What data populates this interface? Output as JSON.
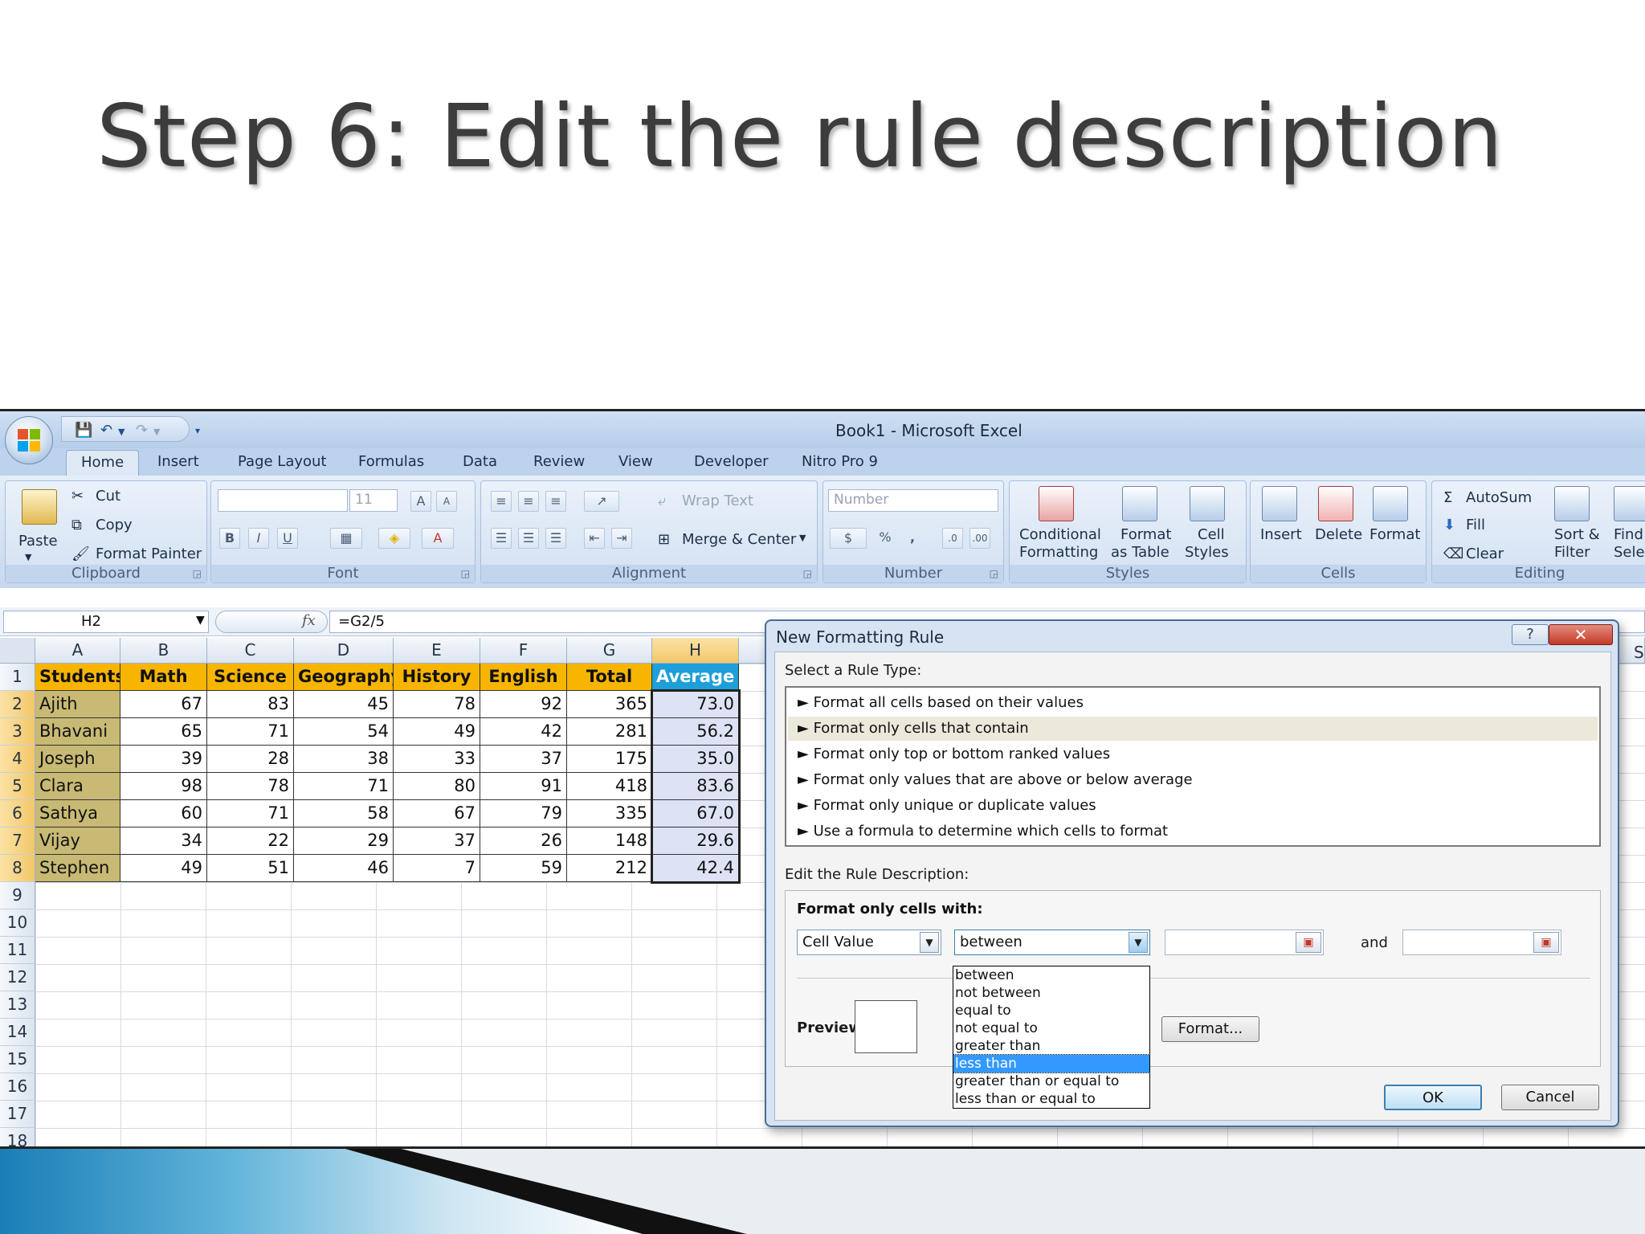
{
  "slide_title": "Step 6: Edit the rule description",
  "window": {
    "title": "Book1 - Microsoft Excel"
  },
  "tabs": [
    "Home",
    "Insert",
    "Page Layout",
    "Formulas",
    "Data",
    "Review",
    "View",
    "Developer",
    "Nitro Pro 9"
  ],
  "ribbon": {
    "clipboard": {
      "label": "Clipboard",
      "paste": "Paste",
      "cut": "Cut",
      "copy": "Copy",
      "format_painter": "Format Painter"
    },
    "font": {
      "label": "Font",
      "size": "11",
      "bold": "B",
      "italic": "I",
      "underline": "U"
    },
    "alignment": {
      "label": "Alignment",
      "wrap_text": "Wrap Text",
      "merge_center": "Merge & Center"
    },
    "number": {
      "label": "Number",
      "format": "Number",
      "percent": "%",
      "comma": ","
    },
    "styles": {
      "label": "Styles",
      "conditional": [
        "Conditional",
        "Formatting"
      ],
      "format_table": [
        "Format",
        "as Table"
      ],
      "cell_styles": [
        "Cell",
        "Styles"
      ]
    },
    "cells": {
      "label": "Cells",
      "insert": "Insert",
      "delete": "Delete",
      "format": "Format"
    },
    "editing": {
      "label": "Editing",
      "autosum": "AutoSum",
      "fill": "Fill",
      "clear": "Clear",
      "sort": [
        "Sort &",
        "Filter"
      ],
      "find": [
        "Find",
        "Selec"
      ]
    }
  },
  "formula_bar": {
    "name_box": "H2",
    "formula": "=G2/5",
    "fx": "fx"
  },
  "sheet": {
    "columns": [
      "A",
      "B",
      "C",
      "D",
      "E",
      "F",
      "G",
      "H"
    ],
    "rows": [
      "1",
      "2",
      "3",
      "4",
      "5",
      "6",
      "7",
      "8",
      "9",
      "10",
      "11",
      "12",
      "13",
      "14",
      "15",
      "16",
      "17",
      "18"
    ],
    "headers": [
      "Students",
      "Math",
      "Science",
      "Geography",
      "History",
      "English",
      "Total",
      "Average"
    ],
    "data": [
      [
        "Ajith",
        "67",
        "83",
        "45",
        "78",
        "92",
        "365",
        "73.0"
      ],
      [
        "Bhavani",
        "65",
        "71",
        "54",
        "49",
        "42",
        "281",
        "56.2"
      ],
      [
        "Joseph",
        "39",
        "28",
        "38",
        "33",
        "37",
        "175",
        "35.0"
      ],
      [
        "Clara",
        "98",
        "78",
        "71",
        "80",
        "91",
        "418",
        "83.6"
      ],
      [
        "Sathya",
        "60",
        "71",
        "58",
        "67",
        "79",
        "335",
        "67.0"
      ],
      [
        "Vijay",
        "34",
        "22",
        "29",
        "37",
        "26",
        "148",
        "29.6"
      ],
      [
        "Stephen",
        "49",
        "51",
        "46",
        "7",
        "59",
        "212",
        "42.4"
      ]
    ],
    "edge_col_label": "S"
  },
  "dialog": {
    "title": "New Formatting Rule",
    "help": "?",
    "close": "✕",
    "select_rule_type": "Select a Rule Type:",
    "rule_types": [
      "► Format all cells based on their values",
      "► Format only cells that contain",
      "► Format only top or bottom ranked values",
      "► Format only values that are above or below average",
      "► Format only unique or duplicate values",
      "► Use a formula to determine which cells to format"
    ],
    "edit_rule_desc": "Edit the Rule Description:",
    "format_only_with": "Format only cells with:",
    "cell_value": "Cell Value",
    "operator": "between",
    "and": "and",
    "preview": "Preview:",
    "format_btn": "Format...",
    "ok": "OK",
    "cancel": "Cancel",
    "operator_options": [
      "between",
      "not between",
      "equal to",
      "not equal to",
      "greater than",
      "less than",
      "greater than or equal to",
      "less than or equal to"
    ]
  },
  "colors": {
    "header_bg": "#f7b500",
    "average_header_bg": "#1e9fd9",
    "name_bg": "#c8b974",
    "selected_col": "#f3c769"
  }
}
